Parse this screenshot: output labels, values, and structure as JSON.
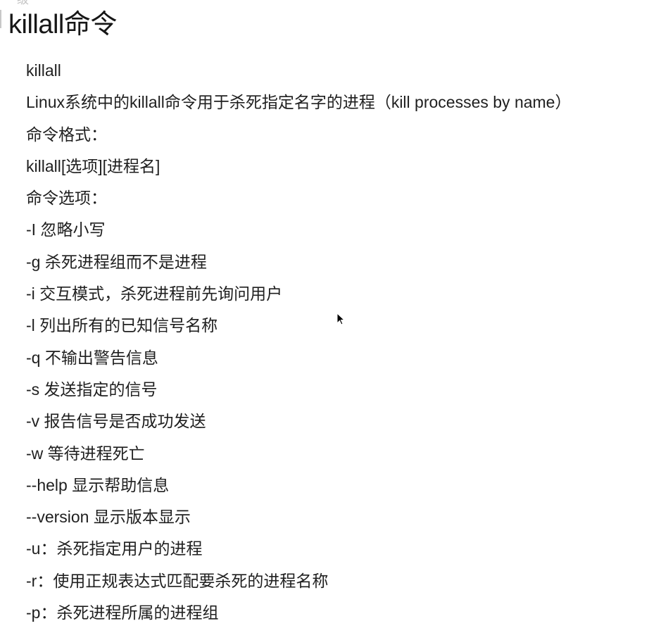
{
  "faint_top_text": "级",
  "title": "killall命令",
  "lines": [
    "killall",
    "Linux系统中的killall命令用于杀死指定名字的进程（kill processes by name）",
    "命令格式：",
    "killall[选项][进程名]",
    "命令选项：",
    "-I 忽略小写",
    "-g 杀死进程组而不是进程",
    "-i 交互模式，杀死进程前先询问用户",
    "-l 列出所有的已知信号名称",
    "-q 不输出警告信息",
    "-s 发送指定的信号",
    "-v 报告信号是否成功发送",
    "-w 等待进程死亡",
    "--help 显示帮助信息",
    "--version 显示版本显示",
    "-u：杀死指定用户的进程",
    "-r：使用正规表达式匹配要杀死的进程名称",
    "-p：杀死进程所属的进程组"
  ],
  "cursor_icon": "mouse-pointer-icon"
}
